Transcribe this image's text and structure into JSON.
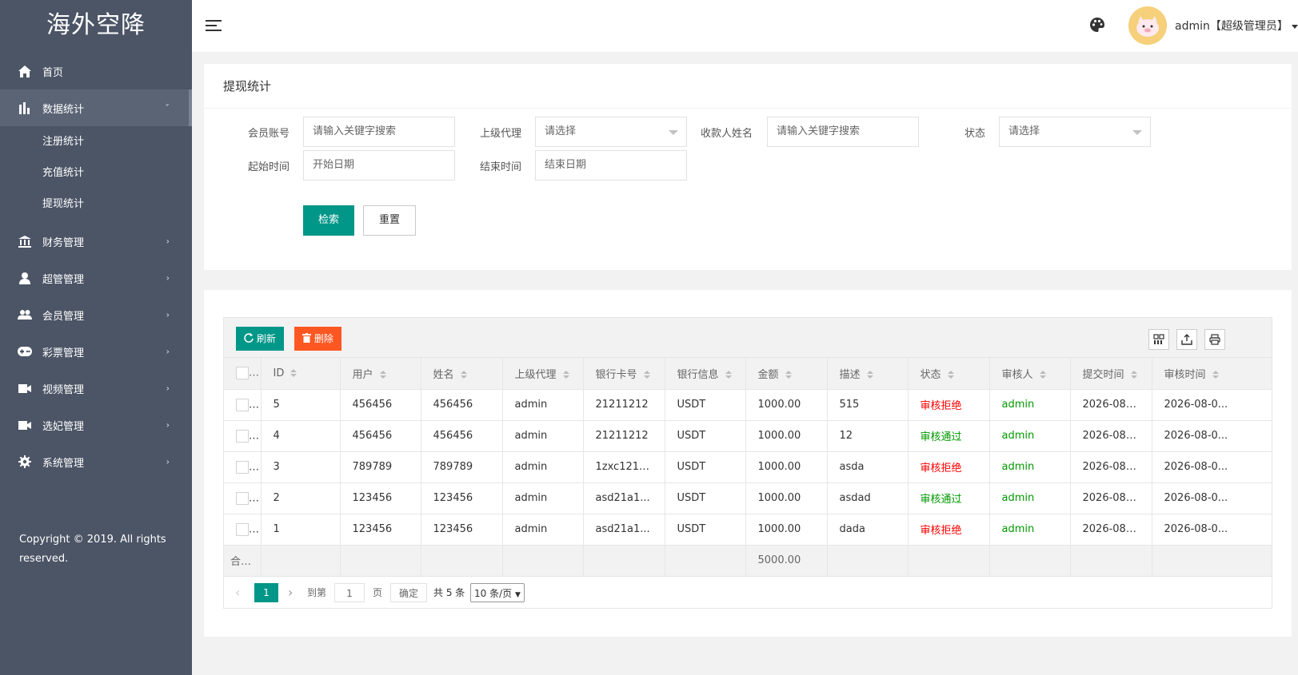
{
  "app": {
    "logo": "海外空降"
  },
  "sidebar": {
    "items": [
      {
        "label": "首页",
        "icon": "home-icon"
      },
      {
        "label": "数据统计",
        "icon": "bar-chart-icon",
        "arrow": "˅"
      },
      {
        "label": "财务管理",
        "icon": "bank-icon",
        "arrow": "›"
      },
      {
        "label": "超管管理",
        "icon": "user-icon",
        "arrow": "›"
      },
      {
        "label": "会员管理",
        "icon": "users-icon",
        "arrow": "›"
      },
      {
        "label": "彩票管理",
        "icon": "gamepad-icon",
        "arrow": "›"
      },
      {
        "label": "视频管理",
        "icon": "video-icon",
        "arrow": "›"
      },
      {
        "label": "选妃管理",
        "icon": "video-camera-icon",
        "arrow": "›"
      },
      {
        "label": "系统管理",
        "icon": "gear-icon",
        "arrow": "›"
      }
    ],
    "submenu": [
      "注册统计",
      "充值统计",
      "提现统计"
    ],
    "copyright_line1": "Copyright © 2019. All rights",
    "copyright_line2": "reserved."
  },
  "header": {
    "user": "admin【超级管理员】"
  },
  "search_panel": {
    "title": "提现统计",
    "fields": {
      "member_label": "会员账号",
      "member_placeholder": "请输入关键字搜索",
      "agent_label": "上级代理",
      "agent_value": "请选择",
      "payee_label": "收款人姓名",
      "payee_placeholder": "请输入关键字搜索",
      "status_label": "状态",
      "status_value": "请选择",
      "start_label": "起始时间",
      "start_placeholder": "开始日期",
      "end_label": "结束时间",
      "end_placeholder": "结束日期"
    },
    "search_btn": "检索",
    "reset_btn": "重置"
  },
  "table": {
    "toolbar": {
      "refresh": "刷新",
      "delete": "删除"
    },
    "columns": [
      "ID",
      "用户",
      "姓名",
      "上级代理",
      "银行卡号",
      "银行信息",
      "金额",
      "描述",
      "状态",
      "审核人",
      "提交时间",
      "审核时间"
    ],
    "rows": [
      [
        "5",
        "456456",
        "456456",
        "admin",
        "21211212",
        "USDT",
        "1000.00",
        "515",
        "审核拒绝",
        "admin",
        "2026-08-...",
        "2026-08-0..."
      ],
      [
        "4",
        "456456",
        "456456",
        "admin",
        "21211212",
        "USDT",
        "1000.00",
        "12",
        "审核通过",
        "admin",
        "2026-08-...",
        "2026-08-0..."
      ],
      [
        "3",
        "789789",
        "789789",
        "admin",
        "1zxc1212...",
        "USDT",
        "1000.00",
        "asda",
        "审核拒绝",
        "admin",
        "2026-08-...",
        "2026-08-0..."
      ],
      [
        "2",
        "123456",
        "123456",
        "admin",
        "asd21a1...",
        "USDT",
        "1000.00",
        "asdad",
        "审核通过",
        "admin",
        "2026-08-...",
        "2026-08-0..."
      ],
      [
        "1",
        "123456",
        "123456",
        "admin",
        "asd21a1...",
        "USDT",
        "1000.00",
        "dada",
        "审核拒绝",
        "admin",
        "2026-08-...",
        "2026-08-0..."
      ]
    ],
    "summary": {
      "label": "合计:",
      "amount": "5000.00"
    },
    "status_colors": {
      "审核拒绝": "#ff0000",
      "审核通过": "#009900"
    }
  },
  "pager": {
    "prev": "‹",
    "current": "1",
    "next": "›",
    "goto_label": "到第",
    "goto_value": "1",
    "page_unit": "页",
    "confirm": "确定",
    "total": "共 5 条",
    "page_size": "10 条/页"
  },
  "colors": {
    "sidebar": "#4c5566",
    "primary": "#009688",
    "danger": "#ff5722"
  }
}
